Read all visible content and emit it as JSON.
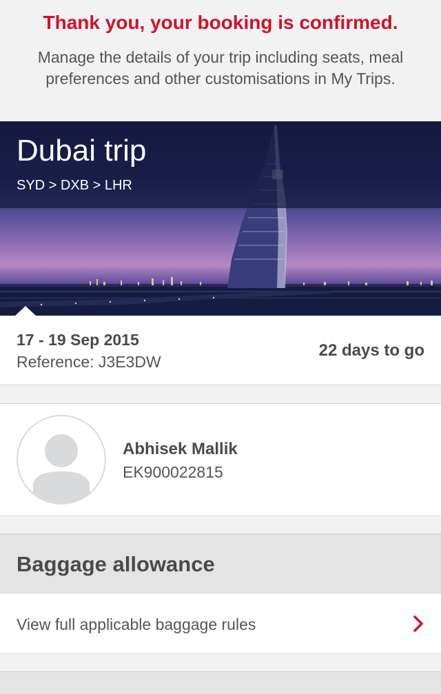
{
  "confirmation": {
    "title": "Thank you, your booking is confirmed.",
    "description": "Manage the details of your trip including seats, meal preferences and other customisations in My Trips."
  },
  "trip": {
    "title": "Dubai trip",
    "route": "SYD > DXB > LHR",
    "dates": "17 - 19 Sep 2015",
    "reference": "Reference: J3E3DW",
    "countdown": "22 days to go"
  },
  "passenger": {
    "name": "Abhisek Mallik",
    "membership": "EK900022815"
  },
  "baggage": {
    "title": "Baggage allowance",
    "rules_link": "View full applicable baggage rules"
  },
  "icons": {
    "avatar": "person-placeholder-icon",
    "chevron": "chevron-right-icon"
  },
  "colors": {
    "accent": "#d0112b",
    "text": "#4a4a4a",
    "background": "#f2f2f2"
  }
}
